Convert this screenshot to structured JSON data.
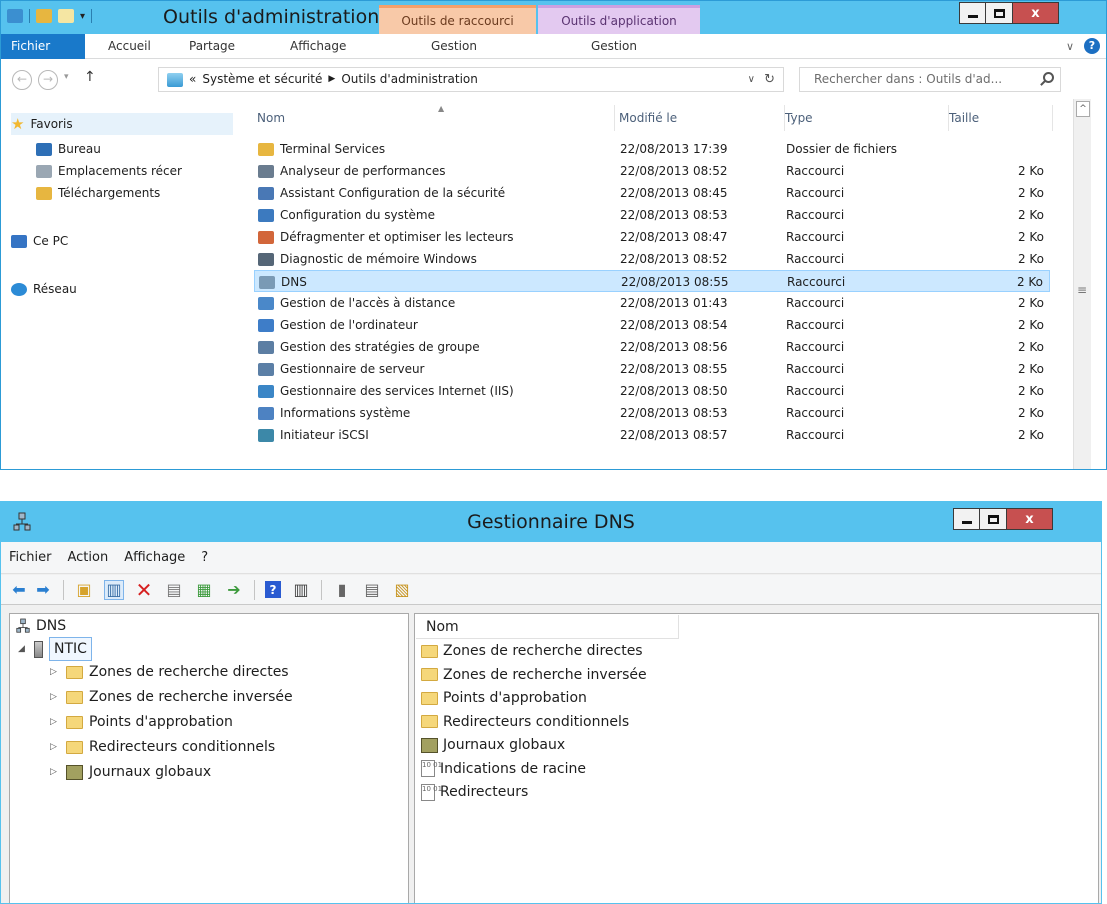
{
  "explorer": {
    "title": "Outils d'administration",
    "context_tabs": [
      "Outils de raccourci",
      "Outils d'application"
    ],
    "ribbon": {
      "file": "Fichier",
      "tabs": [
        "Accueil",
        "Partage",
        "Affichage",
        "Gestion",
        "Gestion"
      ]
    },
    "address": {
      "prefix": "«",
      "crumbs": [
        "Système et sécurité",
        "Outils d'administration"
      ],
      "search_placeholder": "Rechercher dans : Outils d'ad..."
    },
    "nav": {
      "favorites": "Favoris",
      "items": [
        "Bureau",
        "Emplacements récer",
        "Téléchargements"
      ],
      "pc": "Ce PC",
      "network": "Réseau"
    },
    "columns": {
      "name": "Nom",
      "modified": "Modifié le",
      "type": "Type",
      "size": "Taille"
    },
    "files": [
      {
        "name": "Terminal Services",
        "date": "22/08/2013 17:39",
        "type": "Dossier de fichiers",
        "size": "",
        "icon": "folder-icon"
      },
      {
        "name": "Analyseur de performances",
        "date": "22/08/2013 08:52",
        "type": "Raccourci",
        "size": "2 Ko",
        "icon": "performance-icon"
      },
      {
        "name": "Assistant Configuration de la sécurité",
        "date": "22/08/2013 08:45",
        "type": "Raccourci",
        "size": "2 Ko",
        "icon": "security-wizard-icon"
      },
      {
        "name": "Configuration du système",
        "date": "22/08/2013 08:53",
        "type": "Raccourci",
        "size": "2 Ko",
        "icon": "sysconfig-icon"
      },
      {
        "name": "Défragmenter et optimiser les lecteurs",
        "date": "22/08/2013 08:47",
        "type": "Raccourci",
        "size": "2 Ko",
        "icon": "defrag-icon"
      },
      {
        "name": "Diagnostic de mémoire Windows",
        "date": "22/08/2013 08:52",
        "type": "Raccourci",
        "size": "2 Ko",
        "icon": "memory-icon"
      },
      {
        "name": "DNS",
        "date": "22/08/2013 08:55",
        "type": "Raccourci",
        "size": "2 Ko",
        "icon": "dns-icon"
      },
      {
        "name": "Gestion de l'accès à distance",
        "date": "22/08/2013 01:43",
        "type": "Raccourci",
        "size": "2 Ko",
        "icon": "remote-access-icon"
      },
      {
        "name": "Gestion de l'ordinateur",
        "date": "22/08/2013 08:54",
        "type": "Raccourci",
        "size": "2 Ko",
        "icon": "computer-mgmt-icon"
      },
      {
        "name": "Gestion des stratégies de groupe",
        "date": "22/08/2013 08:56",
        "type": "Raccourci",
        "size": "2 Ko",
        "icon": "gpo-icon"
      },
      {
        "name": "Gestionnaire de serveur",
        "date": "22/08/2013 08:55",
        "type": "Raccourci",
        "size": "2 Ko",
        "icon": "server-manager-icon"
      },
      {
        "name": "Gestionnaire des services Internet (IIS)",
        "date": "22/08/2013 08:50",
        "type": "Raccourci",
        "size": "2 Ko",
        "icon": "iis-icon"
      },
      {
        "name": "Informations système",
        "date": "22/08/2013 08:53",
        "type": "Raccourci",
        "size": "2 Ko",
        "icon": "sysinfo-icon"
      },
      {
        "name": "Initiateur iSCSI",
        "date": "22/08/2013 08:57",
        "type": "Raccourci",
        "size": "2 Ko",
        "icon": "iscsi-icon"
      }
    ],
    "selected_file": "DNS"
  },
  "dns": {
    "title": "Gestionnaire DNS",
    "menu": [
      "Fichier",
      "Action",
      "Affichage",
      "?"
    ],
    "tree": {
      "root": "DNS",
      "server": "NTIC",
      "children": [
        "Zones de recherche directes",
        "Zones de recherche inversée",
        "Points d'approbation",
        "Redirecteurs conditionnels",
        "Journaux globaux"
      ]
    },
    "list_header": "Nom",
    "list_items": [
      {
        "label": "Zones de recherche directes",
        "icon": "folder-icon"
      },
      {
        "label": "Zones de recherche inversée",
        "icon": "folder-icon"
      },
      {
        "label": "Points d'approbation",
        "icon": "folder-icon"
      },
      {
        "label": "Redirecteurs conditionnels",
        "icon": "folder-icon"
      },
      {
        "label": "Journaux globaux",
        "icon": "journal-icon"
      },
      {
        "label": "Indications de racine",
        "icon": "document-icon"
      },
      {
        "label": "Redirecteurs",
        "icon": "document-icon"
      }
    ]
  },
  "colors": {
    "titlebar": "#56c2ee",
    "file_tab": "#1979ca",
    "close": "#c75050",
    "selection": "#cce8ff"
  }
}
